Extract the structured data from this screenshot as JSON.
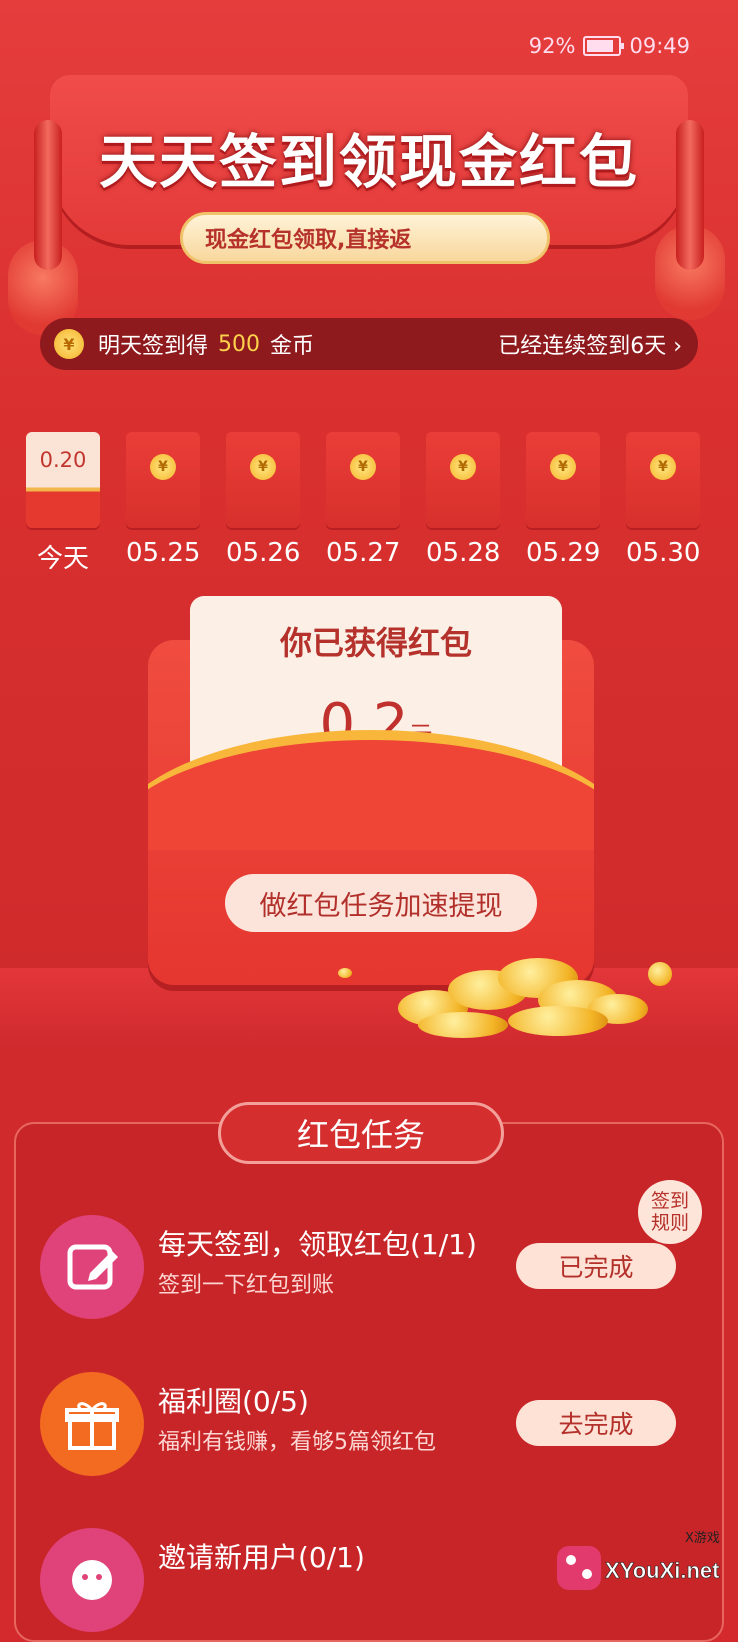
{
  "status_bar": {
    "battery": "92%",
    "time": "09:49"
  },
  "banner": {
    "title": "天天签到领现金红包",
    "subtitle": "现金红包领取,直接返"
  },
  "checkin_bar": {
    "prefix": "明天签到得",
    "coins": "500",
    "suffix": "金币",
    "streak": "已经连续签到6天"
  },
  "days": [
    {
      "label": "今天",
      "amount": "0.20"
    },
    {
      "label": "05.25"
    },
    {
      "label": "05.26"
    },
    {
      "label": "05.27"
    },
    {
      "label": "05.28"
    },
    {
      "label": "05.29"
    },
    {
      "label": "05.30"
    }
  ],
  "reward": {
    "title": "你已获得红包",
    "amount": "0.2",
    "unit": "元",
    "button": "做红包任务加速提现"
  },
  "tasks_panel": {
    "header": "红包任务",
    "rules_badge": "签到规则",
    "items": [
      {
        "title": "每天签到，领取红包(1/1)",
        "desc": "签到一下红包到账",
        "button": "已完成",
        "icon": "edit-icon",
        "color": "#e0437a"
      },
      {
        "title": "福利圈(0/5)",
        "desc": "福利有钱赚，看够5篇领红包",
        "button": "去完成",
        "icon": "gift-icon",
        "color": "#f36a21"
      },
      {
        "title": "邀请新用户(0/1)",
        "desc": "",
        "button": "",
        "icon": "smiley-icon",
        "color": "#e0437a"
      }
    ]
  },
  "watermark": {
    "top": "X游戏",
    "brand": "XYouXi.net"
  },
  "colors": {
    "primary_red": "#d42a2e",
    "gold": "#f5b52b",
    "cream": "#fcefe6"
  }
}
